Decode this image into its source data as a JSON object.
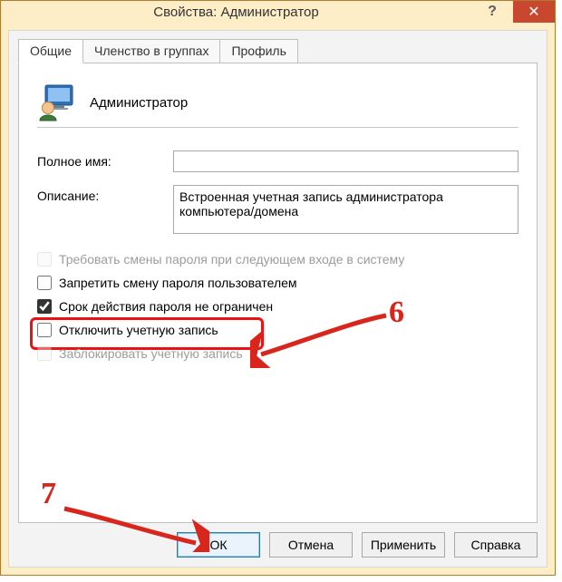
{
  "title": "Свойства: Администратор",
  "titlebar": {
    "help": "?",
    "close": "✕"
  },
  "tabs": {
    "general": "Общие",
    "memberof": "Членство в группах",
    "profile": "Профиль"
  },
  "user": {
    "display_name": "Администратор"
  },
  "fields": {
    "full_name_label": "Полное имя:",
    "full_name_value": "",
    "description_label": "Описание:",
    "description_value": "Встроенная учетная запись администратора компьютера/домена"
  },
  "checks": {
    "must_change": "Требовать смены пароля при следующем входе в систему",
    "cannot_change": "Запретить смену пароля пользователем",
    "never_expires": "Срок действия пароля не ограничен",
    "disable_account": "Отключить учетную запись",
    "lock_account": "Заблокировать учетную запись"
  },
  "buttons": {
    "ok": "ОК",
    "cancel": "Отмена",
    "apply": "Применить",
    "help": "Справка"
  },
  "annot": {
    "n6": "6",
    "n7": "7"
  }
}
